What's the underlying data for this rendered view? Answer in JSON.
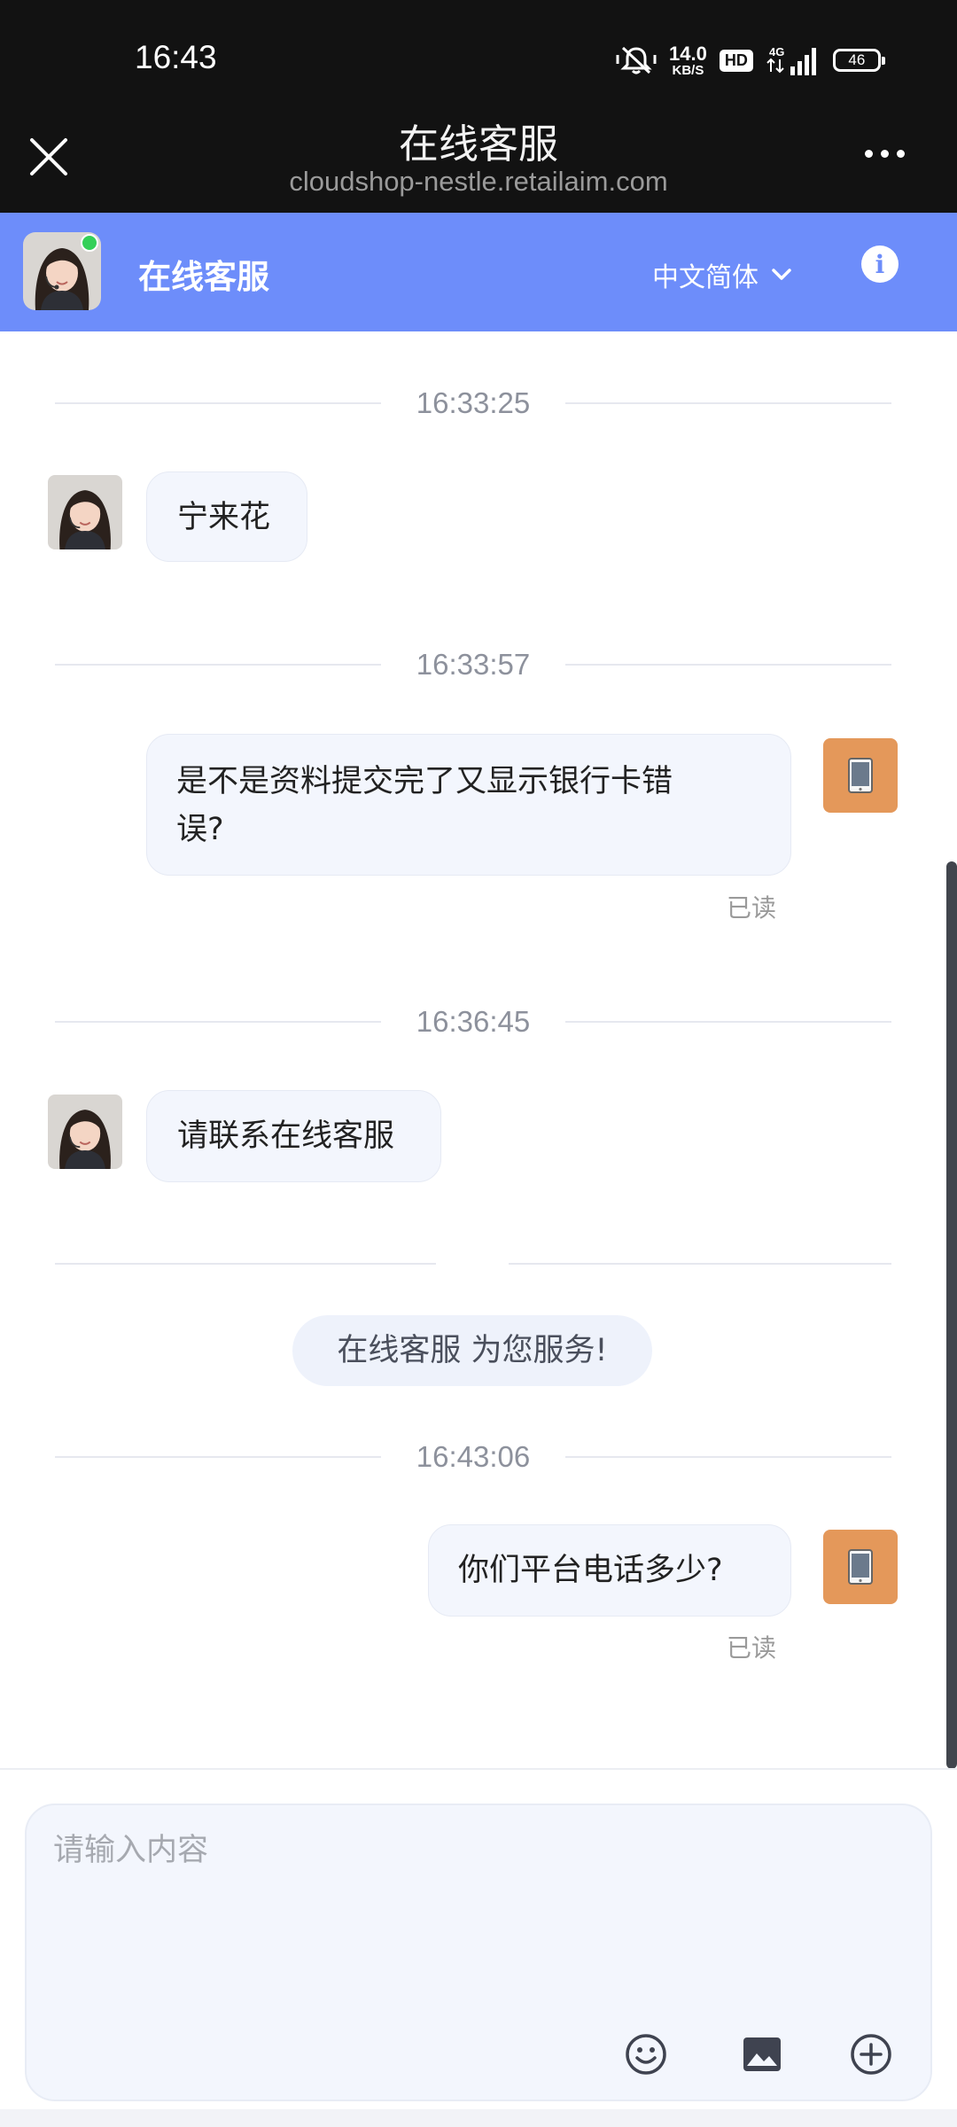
{
  "status_bar": {
    "time": "16:43",
    "net_speed": "14.0",
    "net_unit": "KB/S",
    "hd": "HD",
    "signal": "4G",
    "battery": "46"
  },
  "browser": {
    "title": "在线客服",
    "url": "cloudshop-nestle.retailaim.com"
  },
  "header": {
    "agent_name": "在线客服",
    "language": "中文简体"
  },
  "messages": [
    {
      "time": "16:33:25",
      "from": "agent",
      "text": "宁来花"
    },
    {
      "time": "16:33:57",
      "from": "user",
      "text_line1": "是不是资料提交完了又显示银行卡错",
      "text_line2": "误?",
      "status": "已读"
    },
    {
      "time": "16:36:45",
      "from": "agent",
      "text": "请联系在线客服"
    },
    {
      "from": "system",
      "text": "在线客服 为您服务!"
    },
    {
      "time": "16:43:06",
      "from": "user",
      "text": "你们平台电话多少?",
      "status": "已读"
    }
  ],
  "composer": {
    "placeholder": "请输入内容"
  },
  "icons": {
    "emoji": "smile-icon",
    "image": "image-icon",
    "more": "plus-circle-icon"
  },
  "colors": {
    "header_blue": "#6d8dfa",
    "device_avatar": "#e4985a",
    "bubble_bg": "#f3f6fd"
  }
}
